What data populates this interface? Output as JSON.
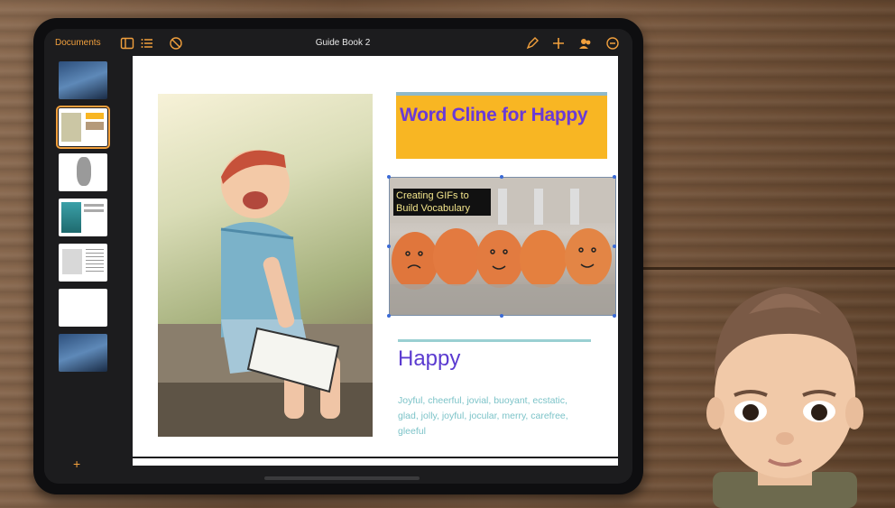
{
  "topbar": {
    "documents_label": "Documents",
    "document_title": "Guide Book 2"
  },
  "sidebar": {
    "add_label": "+",
    "thumbnails": [
      {
        "name": "page-1",
        "selected": false
      },
      {
        "name": "page-2",
        "selected": true
      },
      {
        "name": "page-3",
        "selected": false
      },
      {
        "name": "page-4",
        "selected": false
      },
      {
        "name": "page-5",
        "selected": false
      },
      {
        "name": "page-6",
        "selected": false
      },
      {
        "name": "page-7",
        "selected": false
      }
    ]
  },
  "page": {
    "heading": "Word Cline for Happy",
    "image_caption": "Creating GIFs to Build Vocabulary",
    "word": "Happy",
    "synonyms": "Joyful, cheerful, jovial, buoyant, ecstatic, glad, jolly, joyful, jocular, merry, carefree, gleeful"
  },
  "colors": {
    "accent": "#f2a03d",
    "heading_bg": "#f8b623",
    "heading_text": "#6a3ad6",
    "word_text": "#5b3bd0",
    "synonym_text": "#7cc3c8"
  },
  "icons": [
    "sidebar-toggle-icon",
    "list-icon",
    "no-entry-icon",
    "pen-icon",
    "plus-icon",
    "collaborate-icon",
    "more-icon"
  ]
}
